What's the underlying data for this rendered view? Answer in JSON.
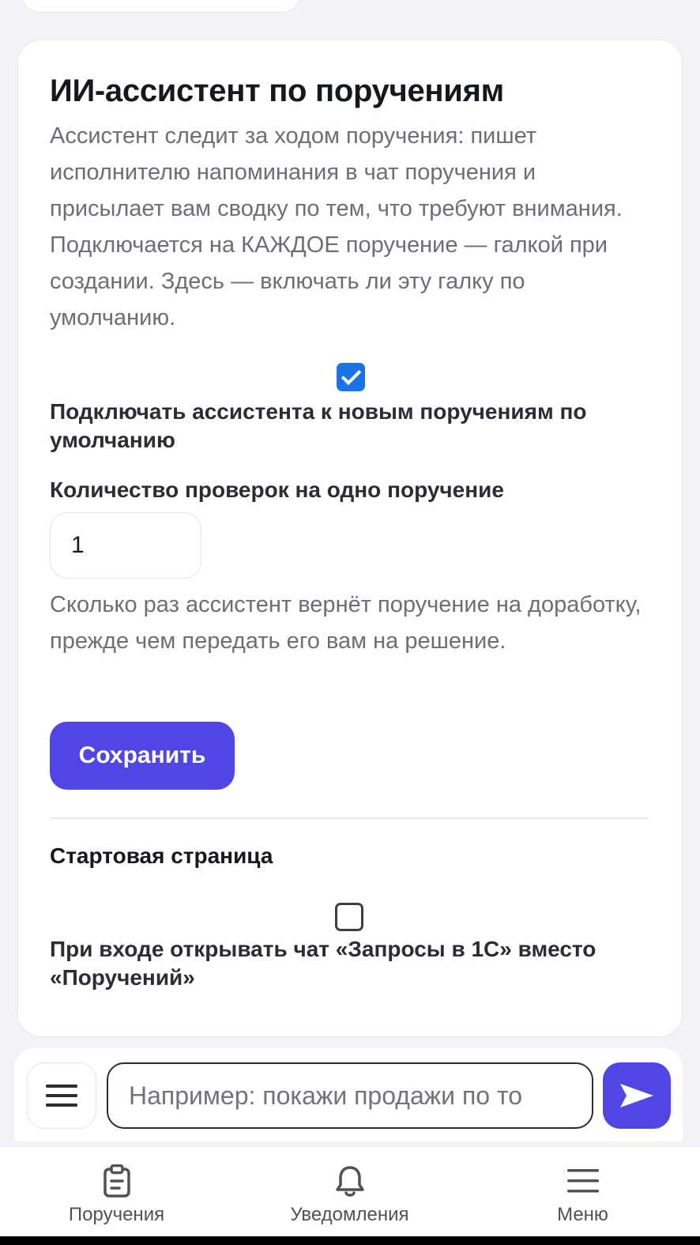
{
  "assistant_settings": {
    "title": "ИИ-ассистент по поручениям",
    "description": "Ассистент следит за ходом поручения: пишет исполнителю напоминания в чат поручения и присылает вам сводку по тем, что требуют внимания. Подключается на КАЖДОЕ поручение — галкой при создании. Здесь — включать ли эту галку по умолчанию.",
    "default_checkbox": {
      "checked": true,
      "label": "Подключать ассистента к новым поручениям по умолчанию"
    },
    "checks_count": {
      "label": "Количество проверок на одно поручение",
      "value": "1",
      "help": "Сколько раз ассистент вернёт поручение на доработку, прежде чем передать его вам на решение."
    },
    "save_label": "Сохранить"
  },
  "start_page": {
    "title": "Стартовая страница",
    "checkbox": {
      "checked": false,
      "label": "При входе открывать чат «Запросы в 1С» вместо «Поручений»"
    }
  },
  "composer": {
    "menu_icon": "hamburger-icon",
    "placeholder": "Например: покажи продажи по то",
    "send_icon": "send-arrow-icon"
  },
  "bottom_nav": {
    "items": [
      {
        "label": "Поручения",
        "icon": "clipboard-icon"
      },
      {
        "label": "Уведомления",
        "icon": "bell-icon"
      },
      {
        "label": "Меню",
        "icon": "hamburger-icon"
      }
    ]
  },
  "colors": {
    "accent": "#4f46e5",
    "checkbox_checked": "#1a73e8",
    "page_background": "#f2f3f7"
  }
}
